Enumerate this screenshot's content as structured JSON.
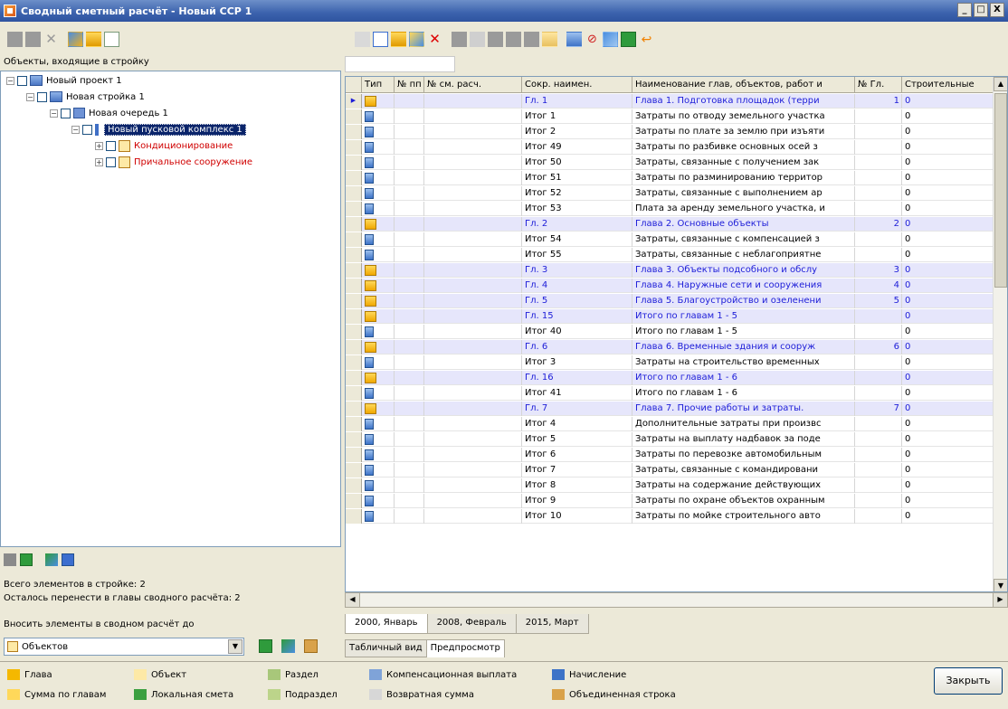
{
  "window": {
    "title": "Сводный сметный расчёт - Новый ССР 1",
    "buttons": [
      "_",
      "□",
      "X"
    ]
  },
  "tree": {
    "header": "Объекты, входящие в стройку",
    "nodes": [
      {
        "label": "Новый проект 1"
      },
      {
        "label": "Новая стройка 1"
      },
      {
        "label": "Новая очередь 1"
      },
      {
        "label": "Новый пусковой комплекс 1"
      },
      {
        "label": "Кондиционирование"
      },
      {
        "label": "Причальное сооружение"
      }
    ]
  },
  "info": {
    "total": "Всего элементов в стройке: 2",
    "remain": "Осталось перенести в главы сводного расчёта: 2",
    "insert_label": "Вносить элементы в сводном расчёт до"
  },
  "combo": {
    "value": "Объектов"
  },
  "grid": {
    "columns": [
      "Тип",
      "№ пп",
      "№ см. расч.",
      "Сокр. наимен.",
      "Наименование глав, объектов, работ и",
      "№ Гл.",
      "Строительные"
    ],
    "rows": [
      {
        "type": "folder",
        "code": "Гл. 1",
        "name": "Глава 1. Подготовка площадок (терри",
        "chapter": "1",
        "val": "0",
        "chap": true,
        "current": true
      },
      {
        "type": "doc",
        "code": "Итог 1",
        "name": "Затраты по отводу земельного участка",
        "chapter": "",
        "val": "0",
        "chap": false
      },
      {
        "type": "doc",
        "code": "Итог 2",
        "name": "Затраты по плате за землю при изъяти",
        "chapter": "",
        "val": "0",
        "chap": false
      },
      {
        "type": "doc",
        "code": "Итог 49",
        "name": "Затраты по разбивке основных осей з",
        "chapter": "",
        "val": "0",
        "chap": false
      },
      {
        "type": "doc",
        "code": "Итог 50",
        "name": "Затраты, связанные с получением зак",
        "chapter": "",
        "val": "0",
        "chap": false
      },
      {
        "type": "doc",
        "code": "Итог 51",
        "name": "Затраты по разминированию территор",
        "chapter": "",
        "val": "0",
        "chap": false
      },
      {
        "type": "doc",
        "code": "Итог 52",
        "name": "Затраты, связанные с выполнением ар",
        "chapter": "",
        "val": "0",
        "chap": false
      },
      {
        "type": "doc",
        "code": "Итог 53",
        "name": "Плата за аренду земельного участка, и",
        "chapter": "",
        "val": "0",
        "chap": false
      },
      {
        "type": "folder",
        "code": "Гл. 2",
        "name": "Глава 2. Основные объекты",
        "chapter": "2",
        "val": "0",
        "chap": true
      },
      {
        "type": "doc",
        "code": "Итог 54",
        "name": "Затраты, связанные с компенсацией з",
        "chapter": "",
        "val": "0",
        "chap": false
      },
      {
        "type": "doc",
        "code": "Итог 55",
        "name": "Затраты, связанные с неблагоприятне",
        "chapter": "",
        "val": "0",
        "chap": false
      },
      {
        "type": "folder",
        "code": "Гл. 3",
        "name": "Глава 3. Объекты подсобного и обслу",
        "chapter": "3",
        "val": "0",
        "chap": true
      },
      {
        "type": "folder",
        "code": "Гл. 4",
        "name": "Глава 4. Наружные сети и сооружения",
        "chapter": "4",
        "val": "0",
        "chap": true
      },
      {
        "type": "folder",
        "code": "Гл. 5",
        "name": "Глава 5. Благоустройство и озеленени",
        "chapter": "5",
        "val": "0",
        "chap": true
      },
      {
        "type": "folder",
        "code": "Гл. 15",
        "name": "Итого по главам 1 - 5",
        "chapter": "",
        "val": "0",
        "chap": true
      },
      {
        "type": "doc",
        "code": "Итог 40",
        "name": "Итого по главам 1 - 5",
        "chapter": "",
        "val": "0",
        "chap": false
      },
      {
        "type": "folder",
        "code": "Гл. 6",
        "name": "Глава 6. Временные здания и сооруж",
        "chapter": "6",
        "val": "0",
        "chap": true
      },
      {
        "type": "doc",
        "code": "Итог 3",
        "name": "Затраты на строительство временных",
        "chapter": "",
        "val": "0",
        "chap": false
      },
      {
        "type": "folder",
        "code": "Гл. 16",
        "name": "Итого по главам 1 - 6",
        "chapter": "",
        "val": "0",
        "chap": true
      },
      {
        "type": "doc",
        "code": "Итог 41",
        "name": "Итого по главам 1 - 6",
        "chapter": "",
        "val": "0",
        "chap": false
      },
      {
        "type": "folder",
        "code": "Гл. 7",
        "name": "Глава 7. Прочие работы и затраты.",
        "chapter": "7",
        "val": "0",
        "chap": true
      },
      {
        "type": "doc",
        "code": "Итог 4",
        "name": "Дополнительные затраты при произвс",
        "chapter": "",
        "val": "0",
        "chap": false
      },
      {
        "type": "doc",
        "code": "Итог 5",
        "name": "Затраты на выплату надбавок за поде",
        "chapter": "",
        "val": "0",
        "chap": false
      },
      {
        "type": "doc",
        "code": "Итог 6",
        "name": "Затраты по перевозке автомобильным",
        "chapter": "",
        "val": "0",
        "chap": false
      },
      {
        "type": "doc",
        "code": "Итог 7",
        "name": "Затраты, связанные с командировани",
        "chapter": "",
        "val": "0",
        "chap": false
      },
      {
        "type": "doc",
        "code": "Итог 8",
        "name": "Затраты на содержание действующих",
        "chapter": "",
        "val": "0",
        "chap": false
      },
      {
        "type": "doc",
        "code": "Итог 9",
        "name": "Затраты по охране объектов охранным",
        "chapter": "",
        "val": "0",
        "chap": false
      },
      {
        "type": "doc",
        "code": "Итог 10",
        "name": "Затраты по мойке строительного авто",
        "chapter": "",
        "val": "0",
        "chap": false
      }
    ]
  },
  "period_tabs": [
    "2000, Январь",
    "2008, Февраль",
    "2015, Март"
  ],
  "view_tabs": [
    "Табличный вид",
    "Предпросмотр"
  ],
  "legend": [
    {
      "label": "Глава",
      "color": "#f5b800"
    },
    {
      "label": "Объект",
      "color": "#fde9a6"
    },
    {
      "label": "Раздел",
      "color": "#a8c77a"
    },
    {
      "label": "Компенсационная выплата",
      "color": "#7fa3d8"
    },
    {
      "label": "Начисление",
      "color": "#3d73c7"
    },
    {
      "label": "Сумма по главам",
      "color": "#ffd85a"
    },
    {
      "label": "Локальная смета",
      "color": "#3ca040"
    },
    {
      "label": "Подраздел",
      "color": "#bcd48a"
    },
    {
      "label": "Возвратная сумма",
      "color": "#d7d7d7"
    },
    {
      "label": "Объединенная строка",
      "color": "#d9a24a"
    }
  ],
  "close_button": "Закрыть"
}
